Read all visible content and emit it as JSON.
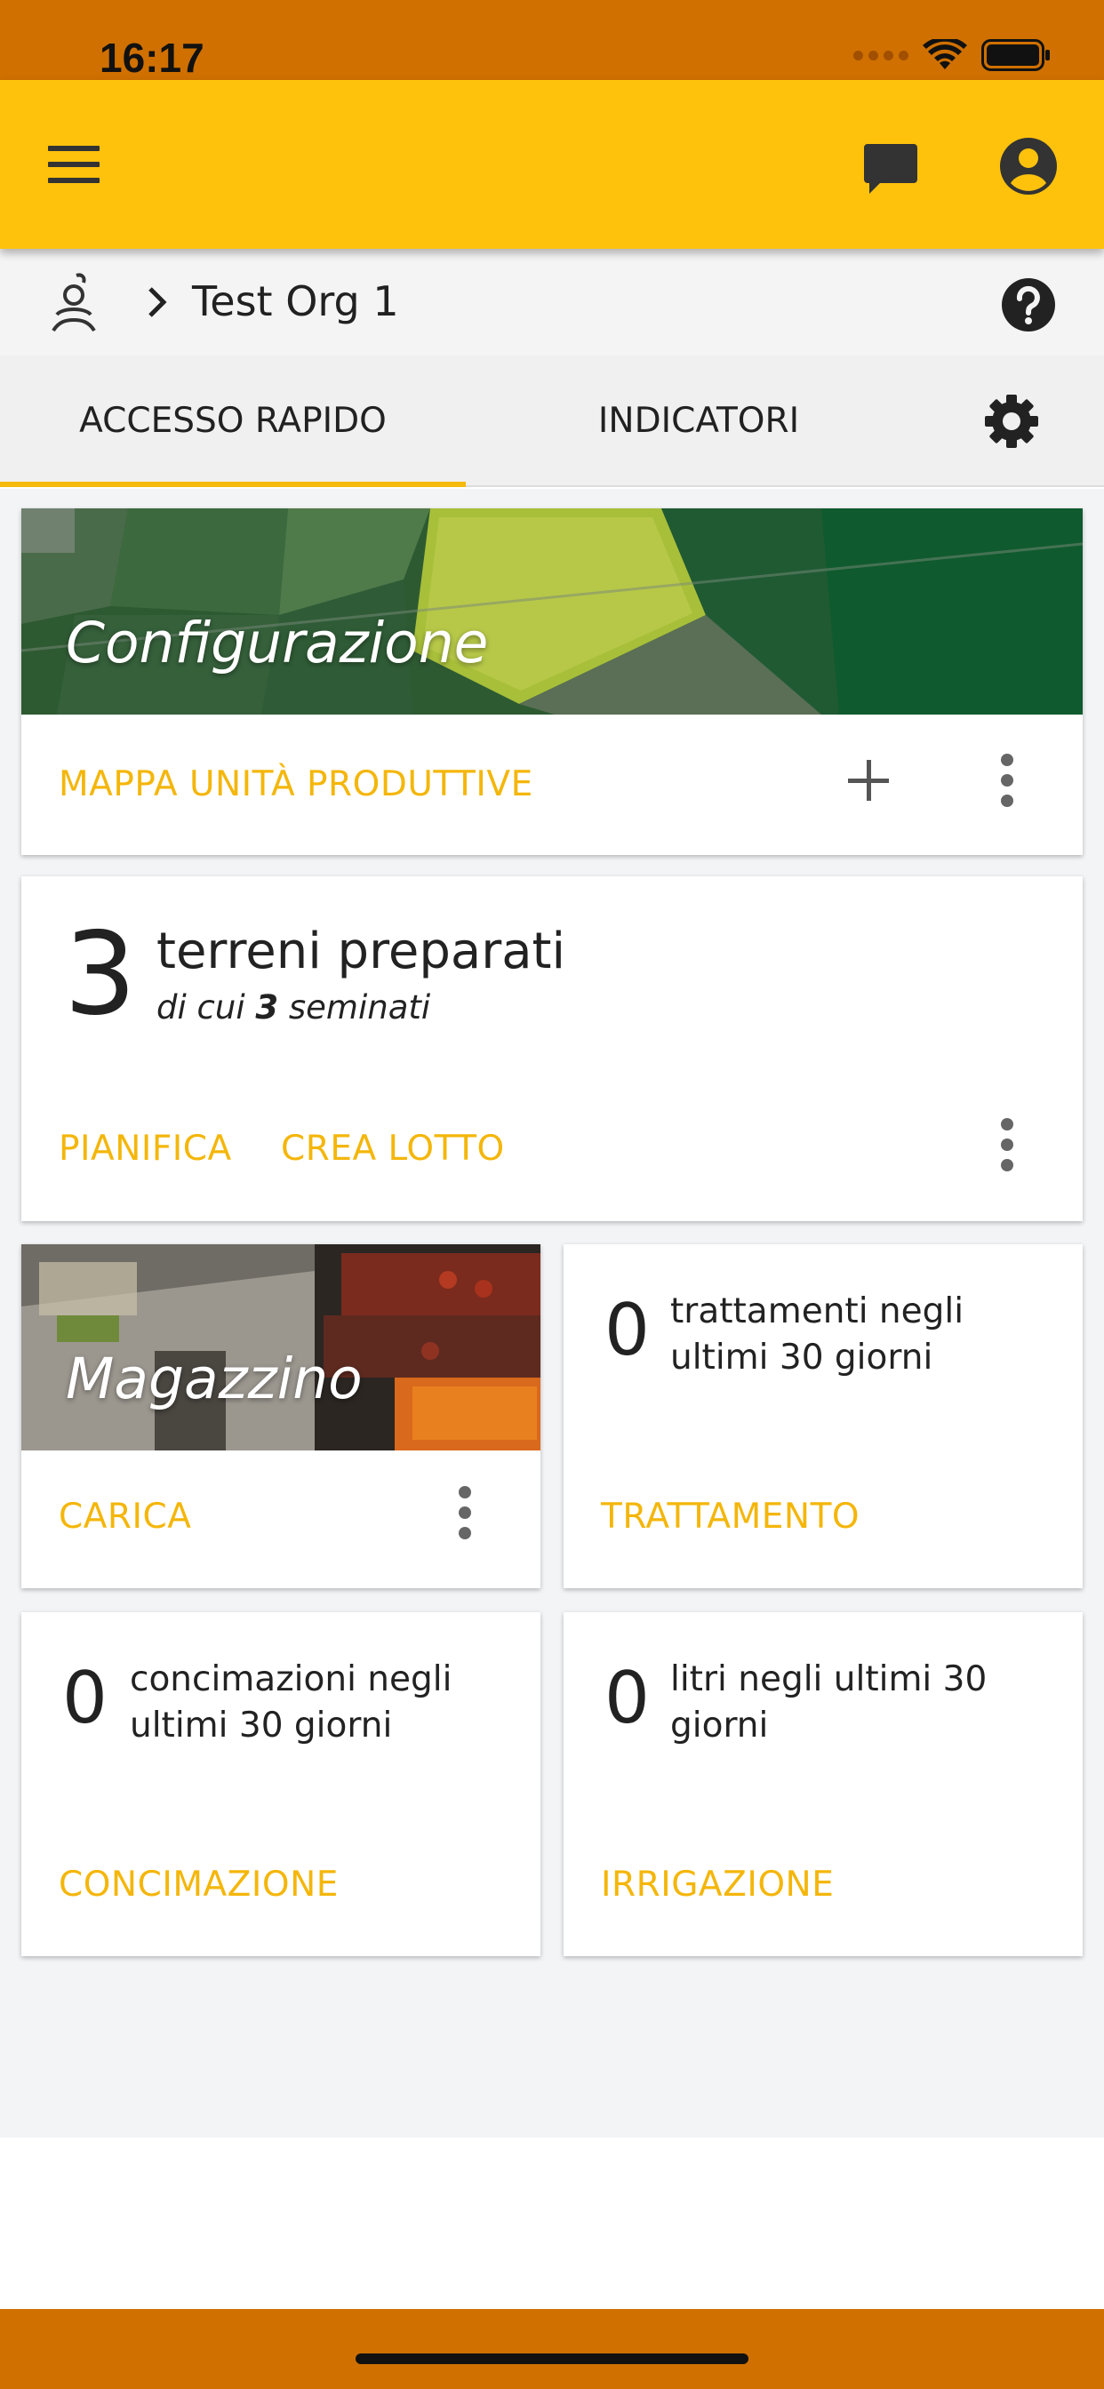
{
  "status_bar": {
    "time": "16:17"
  },
  "org": {
    "name": "Test Org 1"
  },
  "tabs": [
    {
      "label": "ACCESSO RAPIDO",
      "active": true
    },
    {
      "label": "INDICATORI",
      "active": false
    }
  ],
  "cards": {
    "configurazione": {
      "title": "Configurazione",
      "action": "MAPPA UNITÀ PRODUTTIVE"
    },
    "terreni": {
      "number": "3",
      "title": "terreni preparati",
      "sub_prefix": "di cui ",
      "sub_number": "3",
      "sub_suffix": " seminati",
      "action1": "PIANIFICA",
      "action2": "CREA LOTTO"
    },
    "magazzino": {
      "title": "Magazzino",
      "action": "CARICA"
    },
    "trattamenti": {
      "number": "0",
      "text": "trattamenti negli ultimi 30 giorni",
      "action": "TRATTAMENTO"
    },
    "concimazioni": {
      "number": "0",
      "text": "concimazioni negli ultimi 30 giorni",
      "action": "CONCIMAZIONE"
    },
    "irrigazione": {
      "number": "0",
      "text": "litri negli ultimi 30 giorni",
      "action": "IRRIGAZIONE"
    }
  },
  "colors": {
    "status_bar": "#cf7000",
    "app_bar": "#fec20d",
    "accent": "#f4b60a",
    "background": "#f3f4f6"
  },
  "icons": [
    "menu-icon",
    "chat-icon",
    "account-icon",
    "org-logo-icon",
    "chevron-right-icon",
    "help-icon",
    "settings-icon",
    "plus-icon",
    "more-vert-icon",
    "wifi-icon",
    "battery-icon"
  ]
}
